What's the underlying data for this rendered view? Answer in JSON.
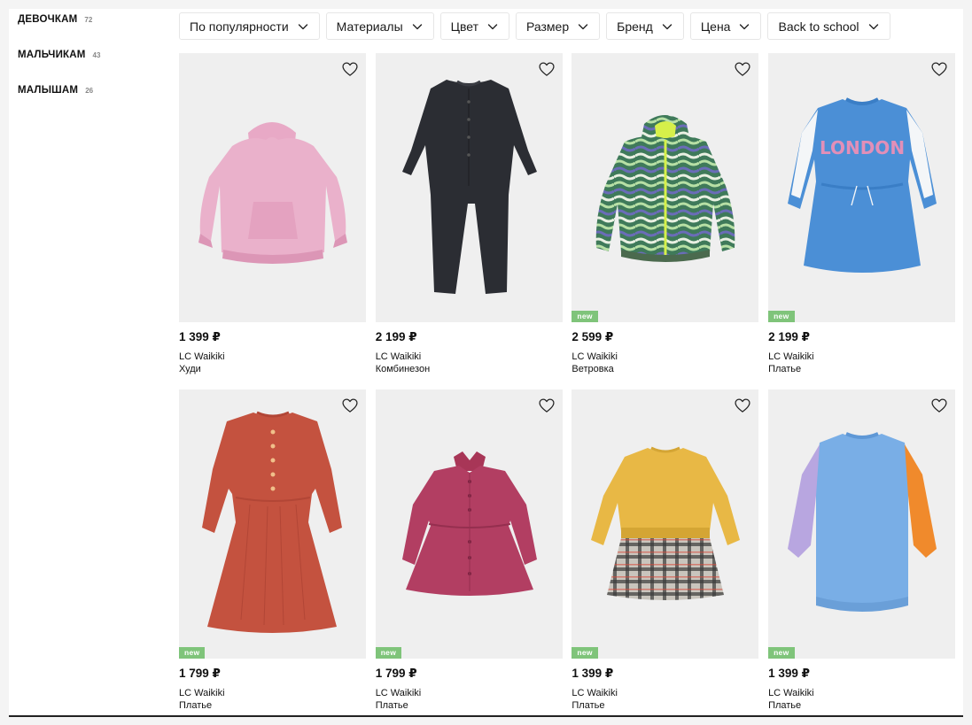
{
  "sidebar": {
    "items": [
      {
        "label": "ДЕВОЧКАМ",
        "count": "72"
      },
      {
        "label": "МАЛЬЧИКАМ",
        "count": "43"
      },
      {
        "label": "МАЛЫШАМ",
        "count": "26"
      }
    ]
  },
  "filters": [
    {
      "label": "По популярности"
    },
    {
      "label": "Материалы"
    },
    {
      "label": "Цвет"
    },
    {
      "label": "Размер"
    },
    {
      "label": "Бренд"
    },
    {
      "label": "Цена"
    },
    {
      "label": "Back to school"
    }
  ],
  "icons": {
    "filter_chevron": "chevron-down-icon",
    "favorite": "heart-icon"
  },
  "colors": {
    "new_badge": "#7fc47a",
    "photo_bg": "#eeeeee"
  },
  "products": [
    {
      "price": "1 399 ₽",
      "brand": "LC Waikiki",
      "type": "Худи",
      "badge": "",
      "garment": "hoodie-pink"
    },
    {
      "price": "2 199 ₽",
      "brand": "LC Waikiki",
      "type": "Комбинезон",
      "badge": "",
      "garment": "jumpsuit-black"
    },
    {
      "price": "2 599 ₽",
      "brand": "LC Waikiki",
      "type": "Ветровка",
      "badge": "new",
      "garment": "windbreaker-green"
    },
    {
      "price": "2 199 ₽",
      "brand": "LC Waikiki",
      "type": "Платье",
      "badge": "new",
      "garment": "sweatdress-blue-london"
    },
    {
      "price": "1 799 ₽",
      "brand": "LC Waikiki",
      "type": "Платье",
      "badge": "new",
      "garment": "dress-red"
    },
    {
      "price": "1 799 ₽",
      "brand": "LC Waikiki",
      "type": "Платье",
      "badge": "new",
      "garment": "dress-berry"
    },
    {
      "price": "1 399 ₽",
      "brand": "LC Waikiki",
      "type": "Платье",
      "badge": "new",
      "garment": "dress-yellow-plaid"
    },
    {
      "price": "1 399 ₽",
      "brand": "LC Waikiki",
      "type": "Платье",
      "badge": "new",
      "garment": "knit-dress-blue"
    }
  ],
  "product_graphic_text": {
    "london": "LONDON"
  }
}
